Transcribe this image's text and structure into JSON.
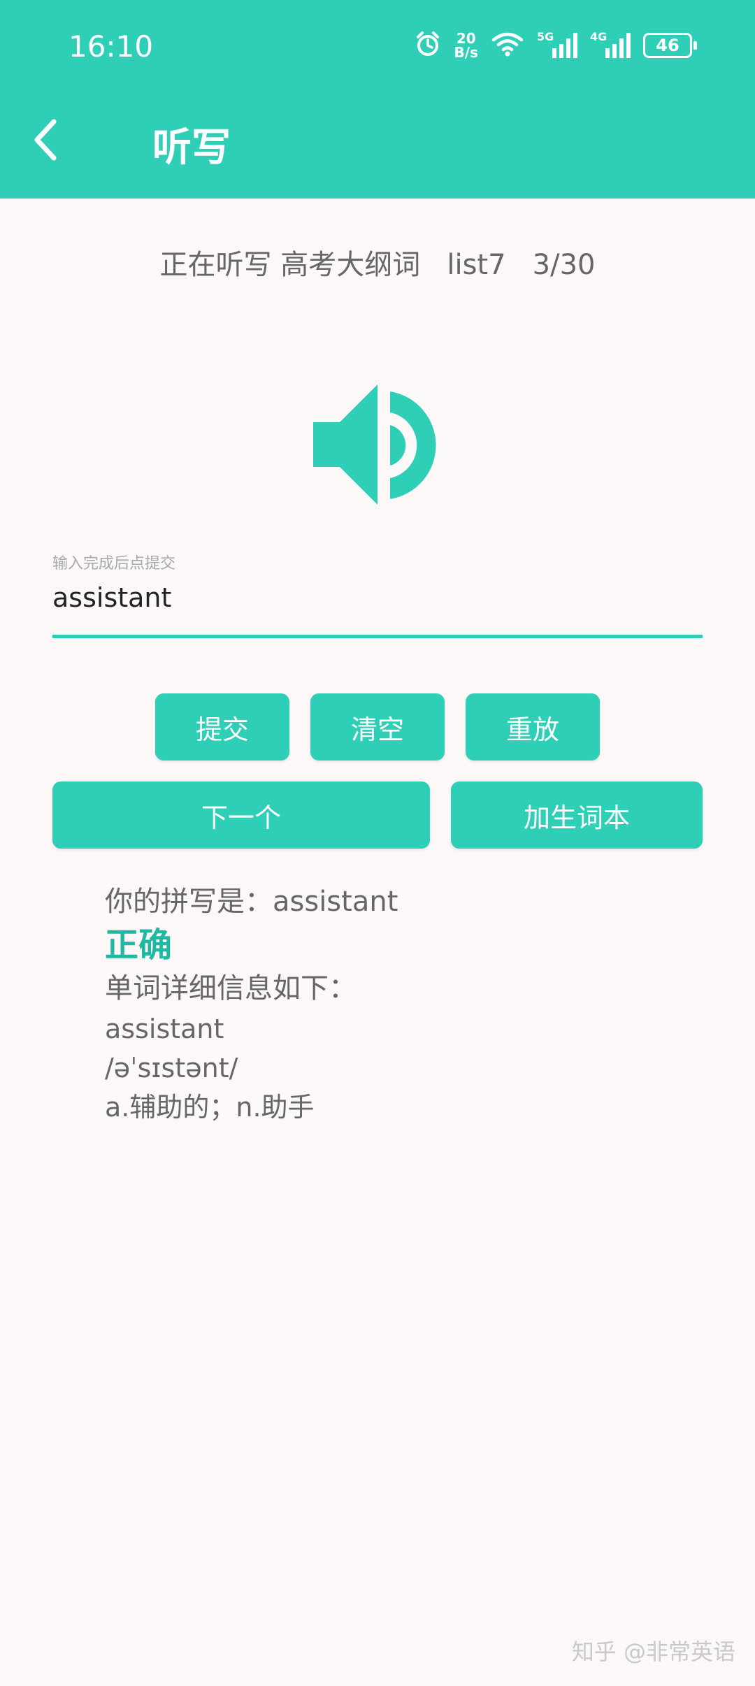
{
  "status_bar": {
    "time": "16:10",
    "net_speed_value": "20",
    "net_speed_unit": "B/s",
    "signal1_label": "5G",
    "signal2_label": "4G",
    "battery": "46",
    "icons": [
      "alarm-icon",
      "wifi-icon",
      "signal-5g-icon",
      "signal-4g-icon",
      "battery-icon"
    ]
  },
  "appbar": {
    "title": "听写",
    "back_icon": "chevron-left-icon",
    "color": "#2fcfb7"
  },
  "subtitle": "正在听写 高考大纲词   list7   3/30",
  "speaker_icon": "speaker-icon",
  "input": {
    "label": "输入完成后点提交",
    "value": "assistant"
  },
  "buttons": {
    "submit": "提交",
    "clear": "清空",
    "replay": "重放",
    "next": "下一个",
    "add_vocab": "加生词本"
  },
  "result": {
    "your_spelling_label": "你的拼写是：",
    "your_spelling_value": "assistant",
    "verdict": "正确",
    "details_label": "单词详细信息如下：",
    "word": "assistant",
    "phonetic": "/əˈsɪstənt/",
    "definition": "a.辅助的；n.助手"
  },
  "watermark": "知乎 @非常英语"
}
